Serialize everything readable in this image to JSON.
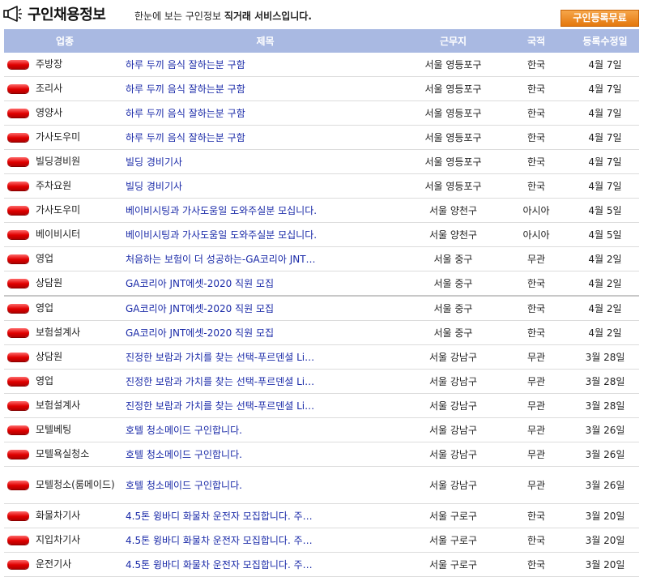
{
  "header": {
    "title": "구인채용정보",
    "subtitle_prefix": "한눈에 보는 구인정보 ",
    "subtitle_bold": "직거래 서비스입니다.",
    "register_button": "구인등록무료",
    "icon": "megaphone-icon"
  },
  "columns": [
    "업종",
    "제목",
    "근무지",
    "국적",
    "등록수정일"
  ],
  "rows": [
    {
      "category": "주방장",
      "title": "하루 두끼 음식 잘하는분 구함",
      "location": "서울 영등포구",
      "nationality": "한국",
      "date": "4월 7일"
    },
    {
      "category": "조리사",
      "title": "하루 두끼 음식 잘하는분 구함",
      "location": "서울 영등포구",
      "nationality": "한국",
      "date": "4월 7일"
    },
    {
      "category": "영양사",
      "title": "하루 두끼 음식 잘하는분 구함",
      "location": "서울 영등포구",
      "nationality": "한국",
      "date": "4월 7일"
    },
    {
      "category": "가사도우미",
      "title": "하루 두끼 음식 잘하는분 구함",
      "location": "서울 영등포구",
      "nationality": "한국",
      "date": "4월 7일"
    },
    {
      "category": "빌딩경비원",
      "title": "빌딩 경비기사",
      "location": "서울 영등포구",
      "nationality": "한국",
      "date": "4월 7일"
    },
    {
      "category": "주차요원",
      "title": "빌딩 경비기사",
      "location": "서울 영등포구",
      "nationality": "한국",
      "date": "4월 7일"
    },
    {
      "category": "가사도우미",
      "title": "베이비시팅과 가사도움일 도와주실분 모십니다.",
      "location": "서울 양천구",
      "nationality": "아시아",
      "date": "4월 5일"
    },
    {
      "category": "베이비시터",
      "title": "베이비시팅과 가사도움일 도와주실분 모십니다.",
      "location": "서울 양천구",
      "nationality": "아시아",
      "date": "4월 5일"
    },
    {
      "category": "영업",
      "title": "처음하는 보험이 더 성공하는-GA코리아 JNT…",
      "location": "서울 중구",
      "nationality": "무관",
      "date": "4월 2일"
    },
    {
      "category": "상담원",
      "title": "GA코리아 JNT에셋-2020 직원 모집",
      "location": "서울 중구",
      "nationality": "한국",
      "date": "4월 2일"
    },
    {
      "category": "영업",
      "title": "GA코리아 JNT에셋-2020 직원 모집",
      "location": "서울 중구",
      "nationality": "한국",
      "date": "4월 2일"
    },
    {
      "category": "보험설계사",
      "title": "GA코리아 JNT에셋-2020 직원 모집",
      "location": "서울 중구",
      "nationality": "한국",
      "date": "4월 2일"
    },
    {
      "category": "상담원",
      "title": "진정한 보람과 가치를 찾는 선택-푸르덴셜 Li…",
      "location": "서울 강남구",
      "nationality": "무관",
      "date": "3월 28일"
    },
    {
      "category": "영업",
      "title": "진정한 보람과 가치를 찾는 선택-푸르덴셜 Li…",
      "location": "서울 강남구",
      "nationality": "무관",
      "date": "3월 28일"
    },
    {
      "category": "보험설계사",
      "title": "진정한 보람과 가치를 찾는 선택-푸르덴셜 Li…",
      "location": "서울 강남구",
      "nationality": "무관",
      "date": "3월 28일"
    },
    {
      "category": "모텔베팅",
      "title": "호텔 청소메이드 구인합니다.",
      "location": "서울 강남구",
      "nationality": "무관",
      "date": "3월 26일"
    },
    {
      "category": "모텔욕실청소",
      "title": "호텔 청소메이드 구인합니다.",
      "location": "서울 강남구",
      "nationality": "무관",
      "date": "3월 26일"
    },
    {
      "category": "모텔청소(룸메이드)",
      "title": "호텔 청소메이드 구인합니다.",
      "location": "서울 강남구",
      "nationality": "무관",
      "date": "3월 26일"
    },
    {
      "category": "화물차기사",
      "title": "4.5톤 윙바디 화물차 운전자 모집합니다. 주…",
      "location": "서울 구로구",
      "nationality": "한국",
      "date": "3월 20일"
    },
    {
      "category": "지입차기사",
      "title": "4.5톤 윙바디 화물차 운전자 모집합니다. 주…",
      "location": "서울 구로구",
      "nationality": "한국",
      "date": "3월 20일"
    },
    {
      "category": "운전기사",
      "title": "4.5톤 윙바디 화물차 운전자 모집합니다. 주…",
      "location": "서울 구로구",
      "nationality": "한국",
      "date": "3월 20일"
    }
  ]
}
